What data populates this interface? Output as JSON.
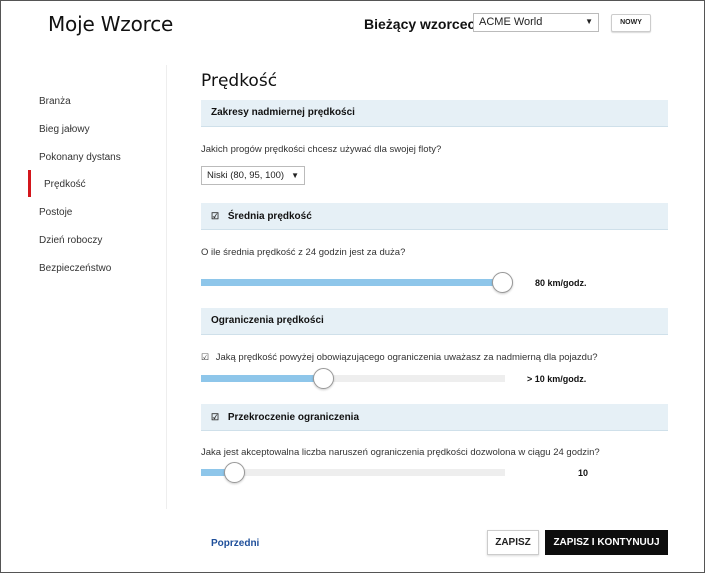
{
  "header": {
    "app_title": "Moje Wzorce",
    "current_template_label": "Bieżący wzorcec :",
    "current_template_value": "ACME World",
    "new_button": "NOWY"
  },
  "sidebar": {
    "items": [
      {
        "label": "Branża",
        "active": false
      },
      {
        "label": "Bieg jałowy",
        "active": false
      },
      {
        "label": "Pokonany dystans",
        "active": false
      },
      {
        "label": "Prędkość",
        "active": true
      },
      {
        "label": "Postoje",
        "active": false
      },
      {
        "label": "Dzień roboczy",
        "active": false
      },
      {
        "label": "Bezpieczeństwo",
        "active": false
      }
    ],
    "active_color": "#d3161c"
  },
  "main": {
    "title": "Prędkość",
    "overspeed": {
      "header": "Zakresy nadmiernej prędkości",
      "question": "Jakich progów prędkości chcesz używać dla swojej floty?",
      "selected_level": "Niski (80, 95, 100)"
    },
    "average_speed": {
      "header": "Średnia prędkość",
      "checked": true,
      "question": "O ile średnia prędkość z 24 godzin jest za duża?",
      "slider_fraction": 0.98,
      "value_label": "80 km/godz."
    },
    "speed_limits": {
      "header": "Ograniczenia prędkości",
      "question": "Jaką prędkość powyżej obowiązującego ograniczenia uważasz za nadmierną dla pojazdu?",
      "checked": true,
      "slider_fraction": 0.4,
      "value_label": "> 10 km/godz."
    },
    "limit_violation": {
      "header": "Przekroczenie ograniczenia",
      "checked": true,
      "question": "Jaka jest akceptowalna liczba naruszeń ograniczenia prędkości dozwolona w ciągu 24 godzin?",
      "slider_fraction": 0.11,
      "value_label": "10"
    }
  },
  "footer": {
    "prev_link": "Poprzedni",
    "save_button": "ZAPISZ",
    "save_continue_button": "ZAPISZ I KONTYNUUJ"
  },
  "colors": {
    "slider_fill": "#8ec6ea",
    "section_bg": "#e6f0f6",
    "link": "#1f4f9a",
    "primary_button": "#0d0d0d"
  }
}
